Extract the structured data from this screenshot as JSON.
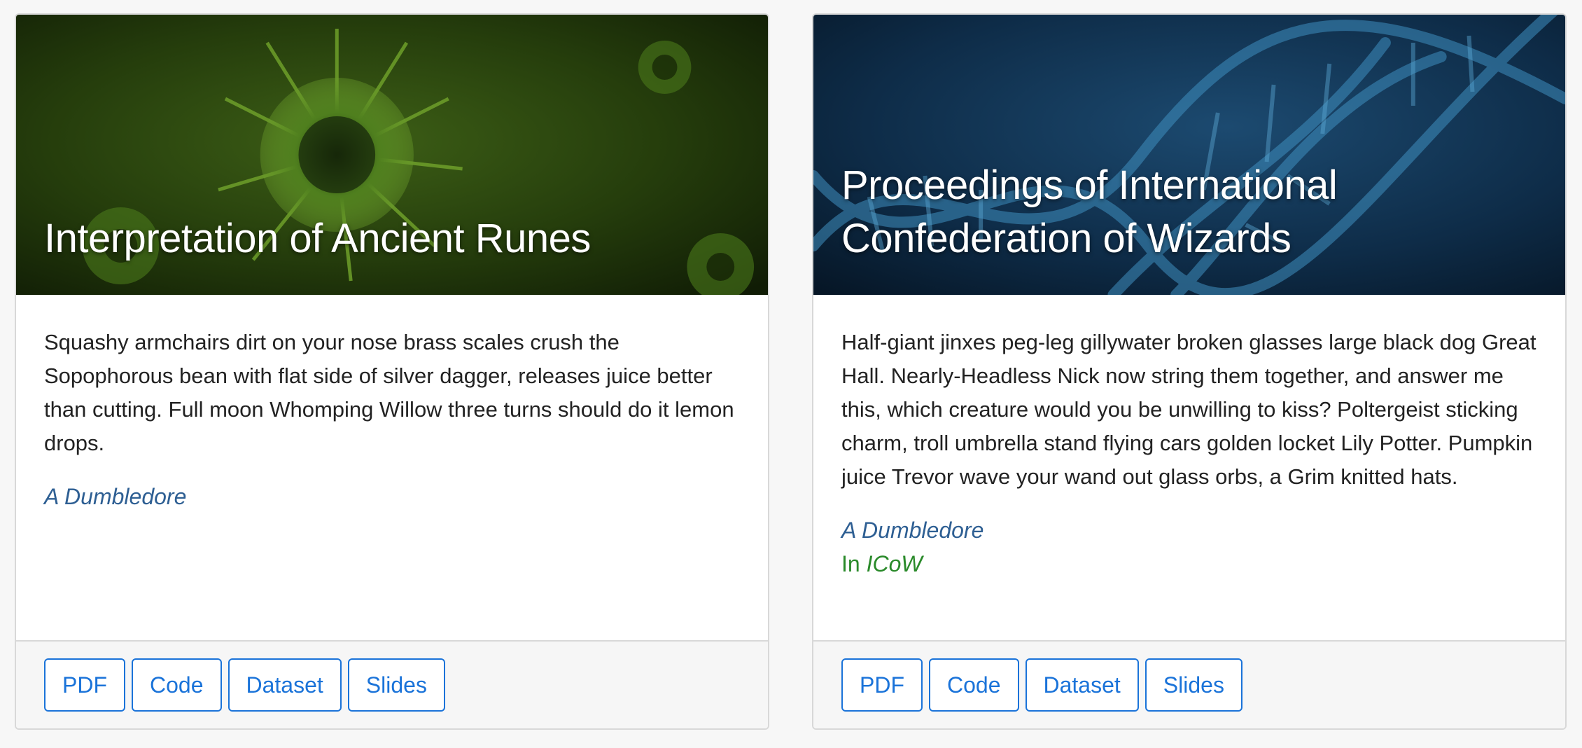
{
  "cards": [
    {
      "title": "Interpretation of Ancient Runes",
      "description": "Squashy armchairs dirt on your nose brass scales crush the Sopophorous bean with flat side of silver dagger, releases juice better than cutting. Full moon Whomping Willow three turns should do it lemon drops.",
      "author": "A Dumbledore",
      "buttons": [
        "PDF",
        "Code",
        "Dataset",
        "Slides"
      ],
      "header_image": "virus-image",
      "header_color": "#2f4a12"
    },
    {
      "title": "Proceedings of International Confederation of Wizards",
      "description": "Half-giant jinxes peg-leg gillywater broken glasses large black dog Great Hall. Nearly-Headless Nick now string them together, and answer me this, which creature would you be unwilling to kiss? Poltergeist sticking charm, troll umbrella stand flying cars golden locket Lily Potter. Pumpkin juice Trevor wave your wand out glass orbs, a Grim knitted hats.",
      "author": "A Dumbledore",
      "venue_prefix": "In",
      "venue": "ICoW",
      "buttons": [
        "PDF",
        "Code",
        "Dataset",
        "Slides"
      ],
      "header_image": "dna-helix-image",
      "header_color": "#0d2a44"
    }
  ],
  "colors": {
    "accent": "#1a73d9",
    "author": "#2e5f93",
    "venue": "#2a8a2a"
  }
}
